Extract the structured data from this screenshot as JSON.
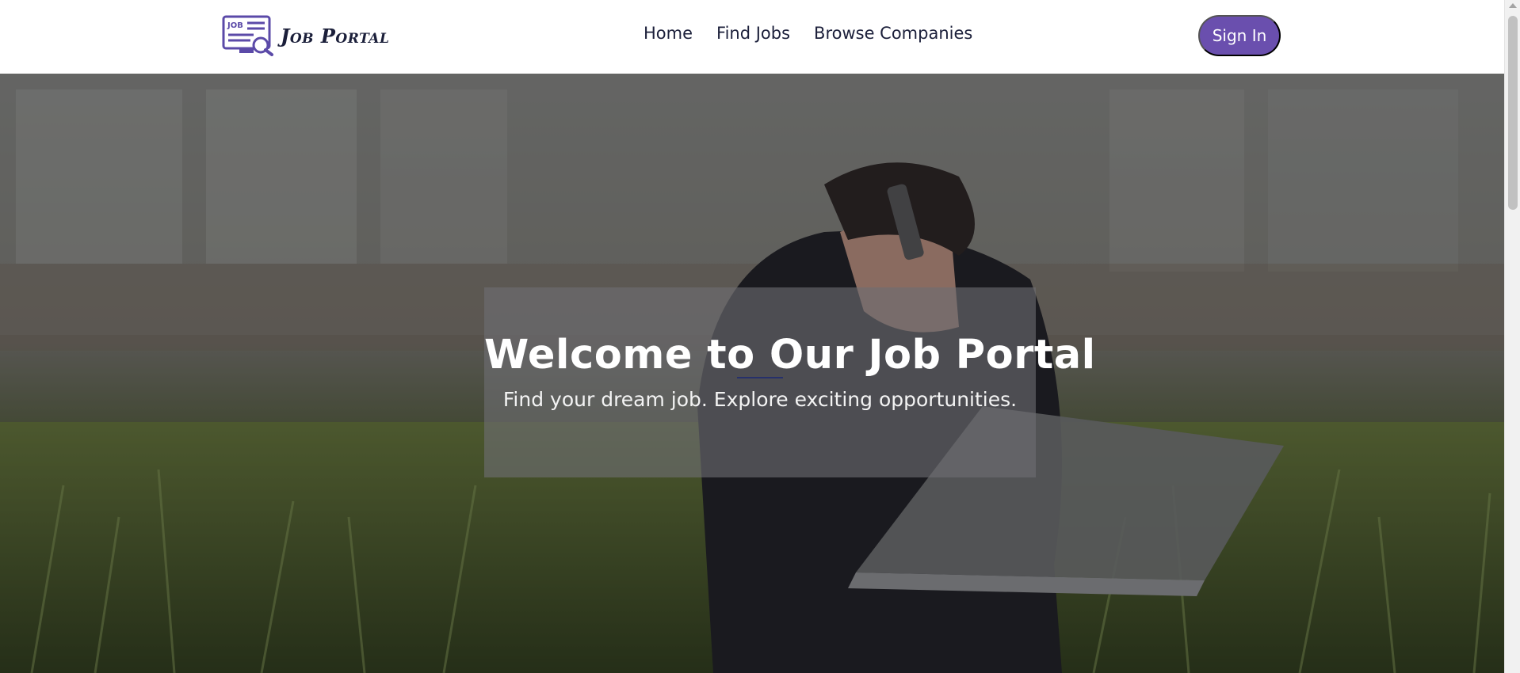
{
  "brand": {
    "name": "Job Portal",
    "logo_text": "JOB",
    "logo_icon": "job-search-icon"
  },
  "nav": {
    "items": [
      {
        "label": "Home"
      },
      {
        "label": "Find Jobs"
      },
      {
        "label": "Browse Companies"
      }
    ]
  },
  "auth": {
    "signin_label": "Sign In"
  },
  "hero": {
    "title": "Welcome to Our Job Portal",
    "subtitle": "Find your dream job. Explore exciting opportunities."
  },
  "colors": {
    "accent": "#6a4fae",
    "text_dark": "#1b1f3a",
    "underline": "#26306b"
  }
}
